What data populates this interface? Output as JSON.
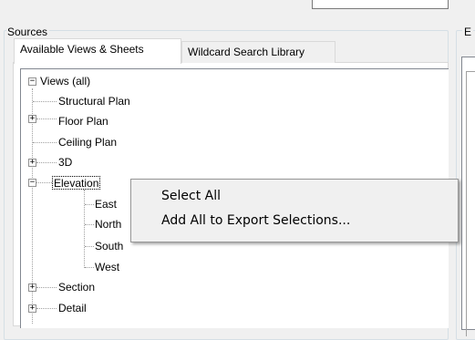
{
  "sources": {
    "title": "Sources",
    "tabs": [
      {
        "label": "Available Views & Sheets"
      },
      {
        "label": "Wildcard Search Library"
      }
    ],
    "tree": {
      "root": "Views (all)",
      "items": [
        {
          "label": "Structural Plan"
        },
        {
          "label": "Floor Plan"
        },
        {
          "label": "Ceiling Plan"
        },
        {
          "label": "3D"
        },
        {
          "label": "Elevation"
        },
        {
          "label": "East"
        },
        {
          "label": "North"
        },
        {
          "label": "South"
        },
        {
          "label": "West"
        },
        {
          "label": "Section"
        },
        {
          "label": "Detail"
        }
      ]
    }
  },
  "right_panel": {
    "title": "E"
  },
  "context_menu": {
    "items": [
      {
        "label": "Select All"
      },
      {
        "label": "Add All to Export Selections..."
      }
    ]
  },
  "expanders": {
    "collapsed": "+",
    "expanded": "−"
  }
}
